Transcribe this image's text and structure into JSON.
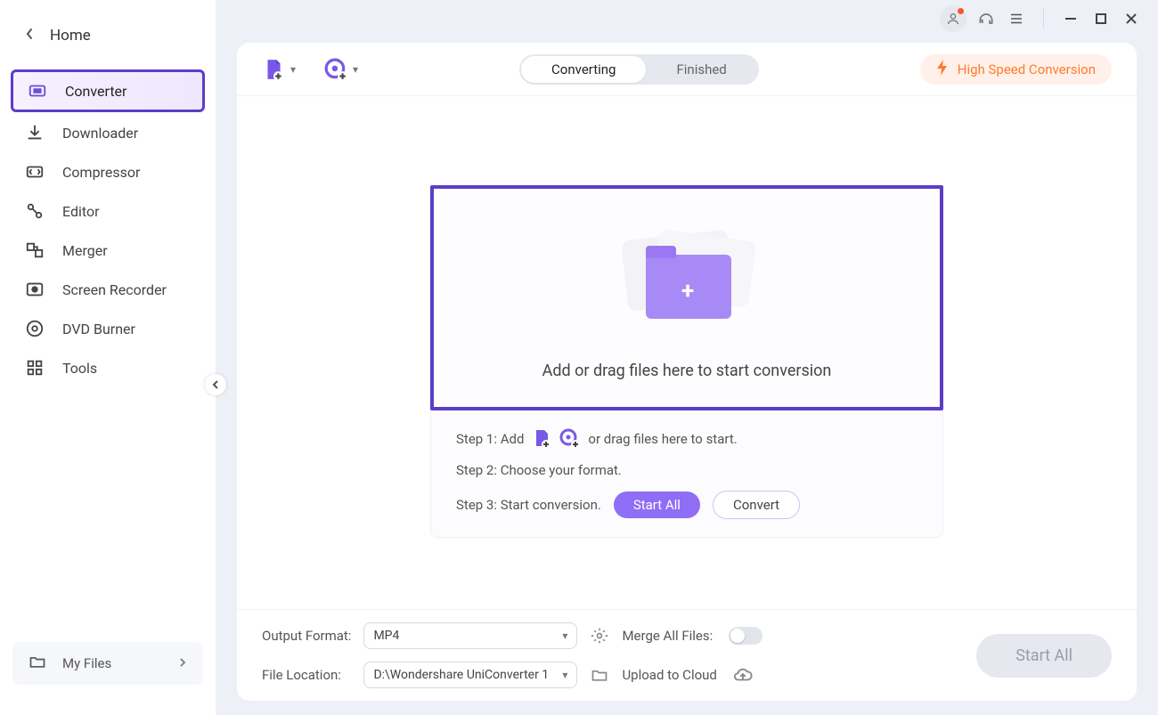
{
  "sidebar": {
    "back_label": "Home",
    "items": [
      {
        "label": "Converter"
      },
      {
        "label": "Downloader"
      },
      {
        "label": "Compressor"
      },
      {
        "label": "Editor"
      },
      {
        "label": "Merger"
      },
      {
        "label": "Screen Recorder"
      },
      {
        "label": "DVD Burner"
      },
      {
        "label": "Tools"
      }
    ],
    "my_files_label": "My Files"
  },
  "tabs": {
    "converting": "Converting",
    "finished": "Finished"
  },
  "hs_label": "High Speed Conversion",
  "dropzone": {
    "text": "Add or drag files here to start conversion"
  },
  "steps": {
    "s1a": "Step 1: Add",
    "s1b": "or drag files here to start.",
    "s2": "Step 2: Choose your format.",
    "s3": "Step 3: Start conversion.",
    "start_all": "Start All",
    "convert": "Convert"
  },
  "footer": {
    "output_format_label": "Output Format:",
    "output_format_value": "MP4",
    "file_location_label": "File Location:",
    "file_location_value": "D:\\Wondershare UniConverter 1",
    "merge_label": "Merge All Files:",
    "upload_label": "Upload to Cloud",
    "start_all": "Start All"
  }
}
